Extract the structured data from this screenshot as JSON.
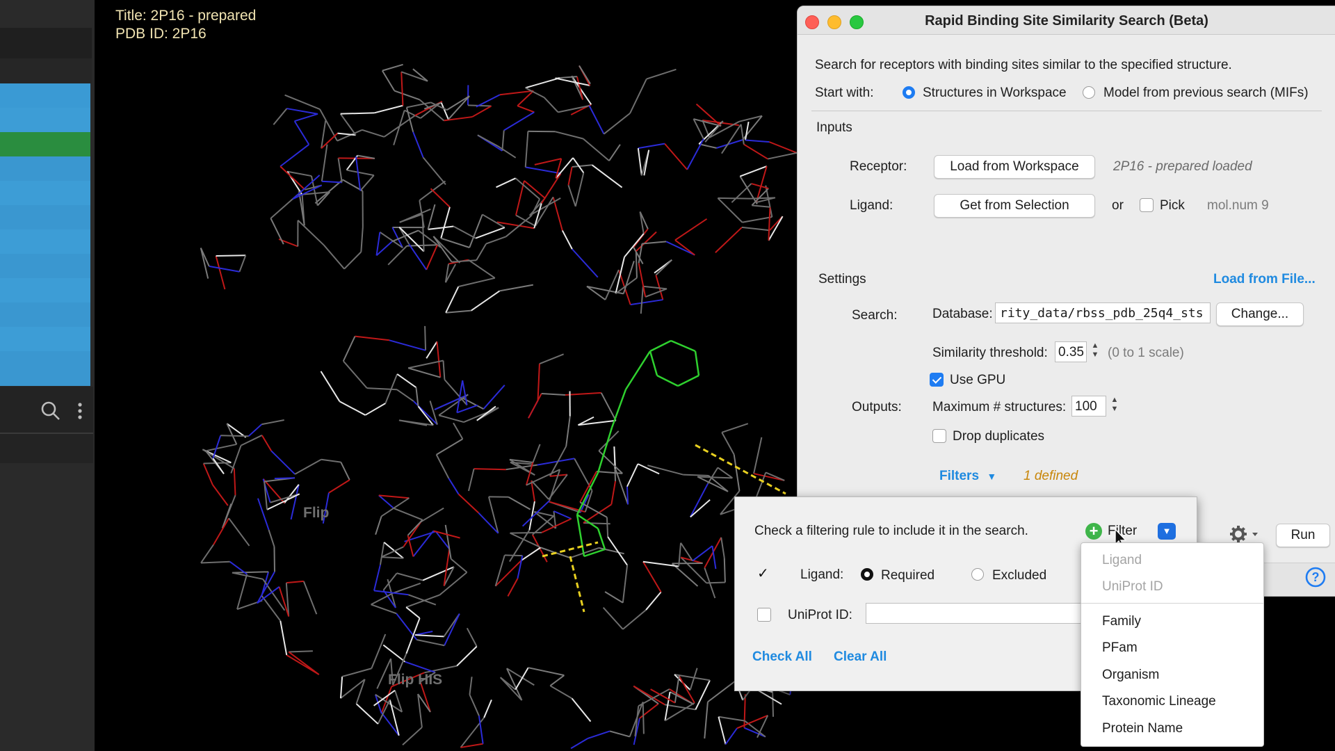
{
  "viewport": {
    "title_line": "Title: 2P16 - prepared",
    "pdb_line": "PDB ID: 2P16",
    "ghost_labels": [
      "Flip",
      "Flip HIS"
    ]
  },
  "dialog": {
    "title": "Rapid Binding Site Similarity Search (Beta)",
    "description": "Search for receptors with binding sites similar to the specified structure.",
    "start_with": {
      "label": "Start with:",
      "options": [
        "Structures in Workspace",
        "Model from previous search (MIFs)"
      ],
      "selected": "Structures in Workspace"
    },
    "inputs": {
      "header": "Inputs",
      "receptor_label": "Receptor:",
      "receptor_button": "Load from Workspace",
      "receptor_status": "2P16 - prepared loaded",
      "ligand_label": "Ligand:",
      "ligand_button": "Get from Selection",
      "or_label": "or",
      "pick_label": "Pick",
      "pick_checked": false,
      "mol_label": "mol.num 9"
    },
    "settings": {
      "header": "Settings",
      "load_from_file": "Load from File...",
      "search_label": "Search:",
      "database_label": "Database:",
      "database_value": "rity_data/rbss_pdb_25q4_sts",
      "change_button": "Change...",
      "similarity_label": "Similarity threshold:",
      "similarity_value": "0.35",
      "similarity_hint": "(0 to 1 scale)",
      "use_gpu_label": "Use GPU",
      "use_gpu_checked": true,
      "outputs_label": "Outputs:",
      "max_structures_label": "Maximum # structures:",
      "max_structures_value": "100",
      "drop_duplicates_label": "Drop duplicates",
      "drop_duplicates_checked": false,
      "filters_label": "Filters",
      "filters_count": "1 defined"
    },
    "run_button": "Run",
    "help_icon": "question-circle-icon",
    "settings_icon": "gear-icon"
  },
  "filter_popup": {
    "instruction": "Check a filtering rule to include it in the search.",
    "add_filter_button": "Filter",
    "ligand_rule": {
      "checked": true,
      "label": "Ligand:",
      "options": [
        "Required",
        "Excluded"
      ],
      "selected": "Required"
    },
    "uniprot_rule": {
      "checked": false,
      "label": "UniProt ID:",
      "value": ""
    },
    "check_all": "Check All",
    "clear_all": "Clear All"
  },
  "filter_menu": {
    "disabled_items": [
      "Ligand",
      "UniProt ID"
    ],
    "items": [
      "Family",
      "PFam",
      "Organism",
      "Taxonomic Lineage",
      "Protein Name"
    ]
  },
  "colors": {
    "accent_blue": "#1e7cf2",
    "link_blue": "#1f8ae0",
    "filters_count_orange": "#c8860a",
    "title_text": "#f1e4b2",
    "ligand_green": "#2fd12f"
  }
}
